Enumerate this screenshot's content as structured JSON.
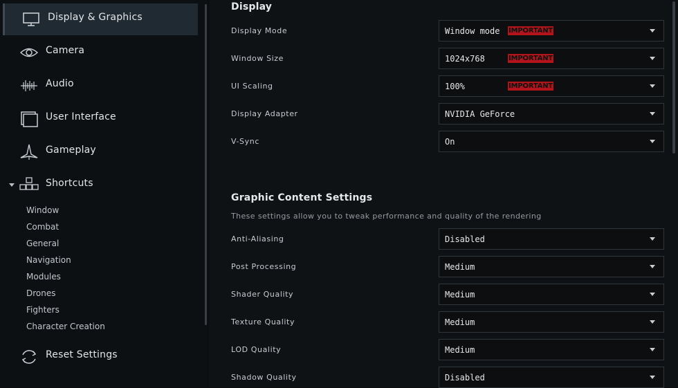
{
  "sidebar": {
    "items": [
      {
        "label": "Display & Graphics",
        "icon": "monitor-icon"
      },
      {
        "label": "Camera",
        "icon": "eye-icon"
      },
      {
        "label": "Audio",
        "icon": "waveform-icon"
      },
      {
        "label": "User Interface",
        "icon": "windows-icon"
      },
      {
        "label": "Gameplay",
        "icon": "ship-icon"
      },
      {
        "label": "Shortcuts",
        "icon": "keys-icon"
      }
    ],
    "subitems": [
      "Window",
      "Combat",
      "General",
      "Navigation",
      "Modules",
      "Drones",
      "Fighters",
      "Character Creation"
    ],
    "reset": {
      "label": "Reset Settings",
      "icon": "refresh-icon"
    }
  },
  "display": {
    "title": "Display",
    "rows": [
      {
        "label": "Display Mode",
        "value": "Window mode",
        "badge": "IMPORTANT"
      },
      {
        "label": "Window Size",
        "value": "1024x768",
        "badge": "IMPORTANT"
      },
      {
        "label": "UI Scaling",
        "value": "100%",
        "badge": "IMPORTANT"
      },
      {
        "label": "Display Adapter",
        "value": "NVIDIA GeForce"
      },
      {
        "label": "V-Sync",
        "value": "On"
      }
    ]
  },
  "graphics": {
    "title": "Graphic Content Settings",
    "description": "These settings allow you to tweak performance and quality of the rendering",
    "rows": [
      {
        "label": "Anti-Aliasing",
        "value": "Disabled"
      },
      {
        "label": "Post Processing",
        "value": "Medium"
      },
      {
        "label": "Shader Quality",
        "value": "Medium"
      },
      {
        "label": "Texture Quality",
        "value": "Medium"
      },
      {
        "label": "LOD Quality",
        "value": "Medium"
      },
      {
        "label": "Shadow Quality",
        "value": "Disabled"
      }
    ]
  },
  "colors": {
    "badge": "#b3131a",
    "active_item": "#1f2a33"
  }
}
